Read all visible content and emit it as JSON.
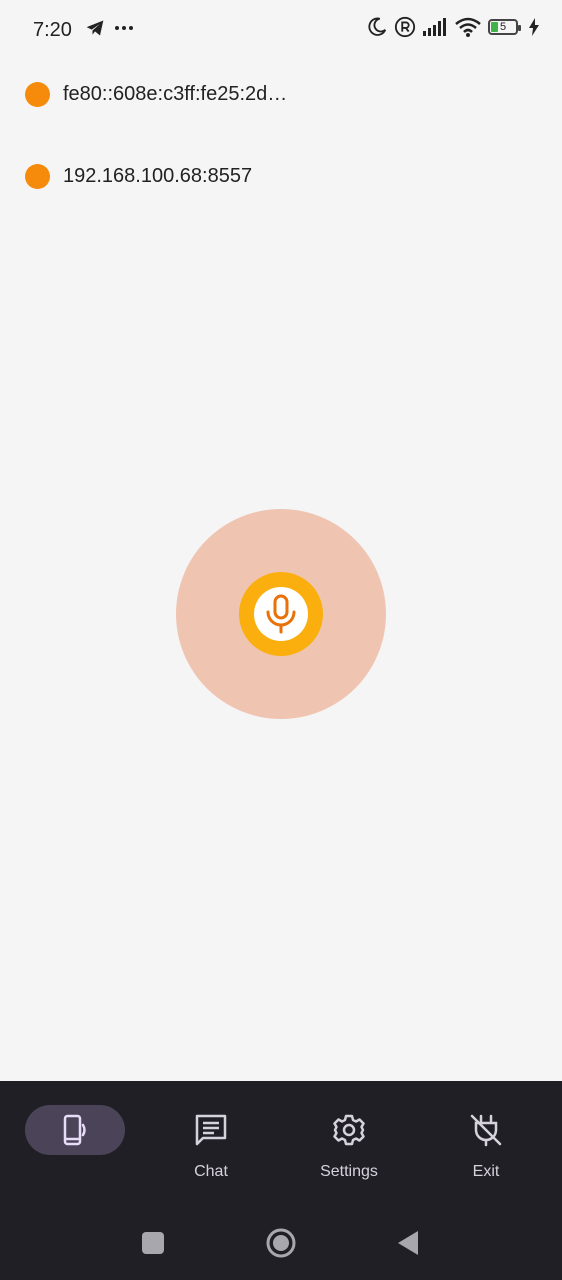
{
  "status_bar": {
    "time": "7:20",
    "battery_level": "5",
    "icons": [
      "telegram-icon",
      "more-icon",
      "moon-icon",
      "registered-icon",
      "signal-icon",
      "wifi-icon",
      "battery-icon",
      "charging-icon"
    ]
  },
  "peers": [
    {
      "address": "fe80::608e:c3ff:fe25:2d…",
      "status_color": "#f58a0b"
    },
    {
      "address": "192.168.100.68:8557",
      "status_color": "#f58a0b"
    }
  ],
  "mic": {
    "icon": "microphone-icon",
    "outer_color": "#efc5b1",
    "ring_color": "#fbaf0e",
    "accent": "#e8710a"
  },
  "bottom_nav": {
    "items": [
      {
        "label": "",
        "icon": "device-cast-icon",
        "selected": true
      },
      {
        "label": "Chat",
        "icon": "chat-icon",
        "selected": false
      },
      {
        "label": "Settings",
        "icon": "gear-icon",
        "selected": false
      },
      {
        "label": "Exit",
        "icon": "plug-off-icon",
        "selected": false
      }
    ]
  },
  "system_nav": [
    "recents-button",
    "home-button",
    "back-button"
  ]
}
